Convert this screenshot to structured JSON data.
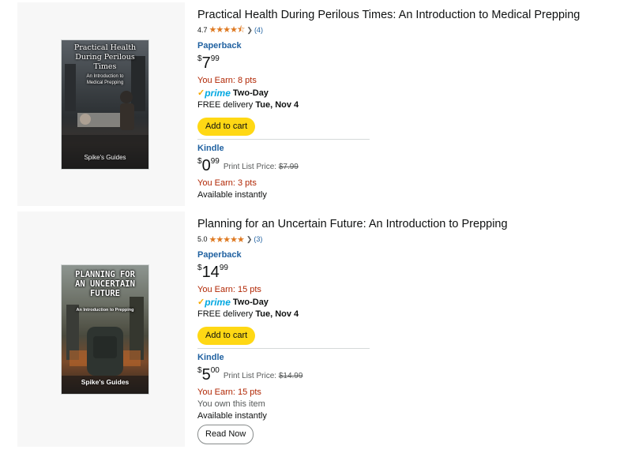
{
  "products": [
    {
      "title": "Practical Health During Perilous Times: An Introduction to Medical Prepping",
      "rating": "4.7",
      "stars": "★★★★⯪",
      "review_count": "(4)",
      "cover": {
        "title": "Practical Health During Perilous Times",
        "subtitle": "An Introduction to Medical Prepping",
        "author": "Spike's Guides"
      },
      "paperback": {
        "label": "Paperback",
        "price_symbol": "$",
        "price_whole": "7",
        "price_fraction": "99",
        "earn": "You Earn: 8 pts",
        "prime_brand": "prime",
        "prime_speed": "Two-Day",
        "delivery_prefix": "FREE delivery ",
        "delivery_date": "Tue, Nov 4",
        "cart_button": "Add to cart"
      },
      "kindle": {
        "label": "Kindle",
        "price_symbol": "$",
        "price_whole": "0",
        "price_fraction": "99",
        "list_label": "Print List Price: ",
        "list_price": "$7.99",
        "earn": "You Earn: 3 pts",
        "availability": "Available instantly"
      }
    },
    {
      "title": "Planning for an Uncertain Future: An Introduction to Prepping",
      "rating": "5.0",
      "stars": "★★★★★",
      "review_count": "(3)",
      "cover": {
        "title": "PLANNING FOR AN UNCERTAIN FUTURE",
        "subtitle": "An Introduction to Prepping",
        "author": "Spike's Guides"
      },
      "paperback": {
        "label": "Paperback",
        "price_symbol": "$",
        "price_whole": "14",
        "price_fraction": "99",
        "earn": "You Earn: 15 pts",
        "prime_brand": "prime",
        "prime_speed": "Two-Day",
        "delivery_prefix": "FREE delivery ",
        "delivery_date": "Tue, Nov 4",
        "cart_button": "Add to cart"
      },
      "kindle": {
        "label": "Kindle",
        "price_symbol": "$",
        "price_whole": "5",
        "price_fraction": "00",
        "list_label": "Print List Price: ",
        "list_price": "$14.99",
        "earn": "You Earn: 15 pts",
        "owned": "You own this item",
        "availability": "Available instantly",
        "read_button": "Read Now"
      }
    }
  ],
  "colors": {
    "accent_link": "#2162a1",
    "earn_red": "#b12704",
    "star": "#de7921",
    "cart_yellow": "#ffd814",
    "prime_blue": "#00a8e1"
  }
}
